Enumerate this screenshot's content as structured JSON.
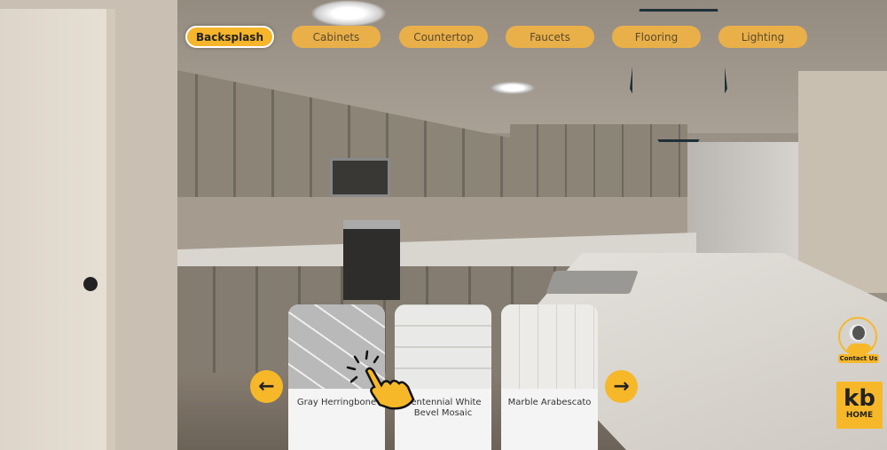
{
  "category_tabs": [
    {
      "label": "Backsplash",
      "active": true
    },
    {
      "label": "Cabinets",
      "active": false
    },
    {
      "label": "Countertop",
      "active": false
    },
    {
      "label": "Faucets",
      "active": false
    },
    {
      "label": "Flooring",
      "active": false
    },
    {
      "label": "Lighting",
      "active": false
    }
  ],
  "options": [
    {
      "label": "Gray Herringbone",
      "pattern": "herringbone"
    },
    {
      "label": "Centennial White Bevel Mosaic",
      "pattern": "subway"
    },
    {
      "label": "Marble Arabescato",
      "pattern": "picket"
    }
  ],
  "nav": {
    "prev_icon": "arrow-left-icon",
    "next_icon": "arrow-right-icon"
  },
  "contact": {
    "label": "Contact Us"
  },
  "logo": {
    "line1": "kb",
    "line2": "HOME"
  },
  "colors": {
    "accent": "#f6b829",
    "tab": "#e9b04a"
  }
}
